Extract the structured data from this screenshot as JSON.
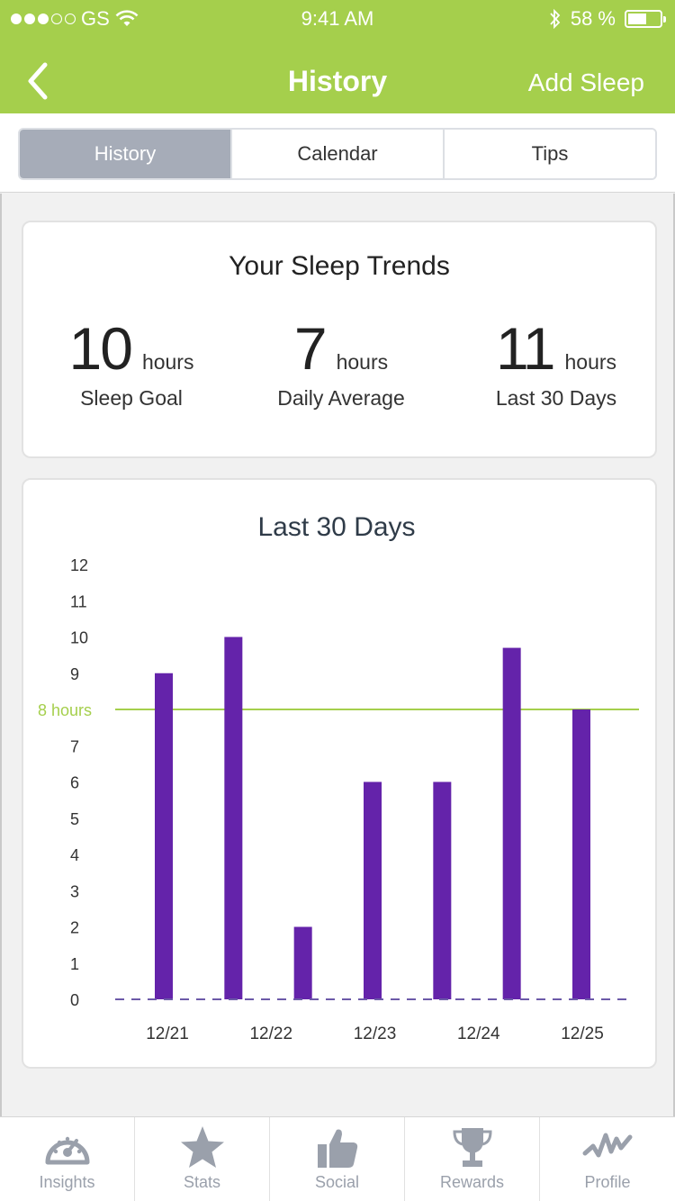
{
  "status_bar": {
    "carrier": "GS",
    "time": "9:41 AM",
    "battery": "58 %"
  },
  "nav": {
    "title": "History",
    "action": "Add Sleep"
  },
  "segments": [
    "History",
    "Calendar",
    "Tips"
  ],
  "trends": {
    "title": "Your Sleep Trends",
    "stats": [
      {
        "value": "10",
        "unit": "hours",
        "label": "Sleep Goal"
      },
      {
        "value": "7",
        "unit": "hours",
        "label": "Daily Average"
      },
      {
        "value": "11",
        "unit": "hours",
        "label": "Last 30 Days"
      }
    ]
  },
  "chart_data": {
    "type": "bar",
    "title": "Last 30 Days",
    "y_ticks": [
      0,
      1,
      2,
      3,
      4,
      5,
      6,
      7,
      8,
      9,
      10,
      11,
      12
    ],
    "ylim": [
      0,
      12
    ],
    "x_tick_labels": [
      "12/21",
      "12/22",
      "12/23",
      "12/24",
      "12/25"
    ],
    "values": [
      9,
      10,
      2,
      6,
      6,
      9.7,
      8
    ],
    "reference_line": {
      "value": 8,
      "label": "8 hours",
      "color": "#a5cf4c"
    },
    "bar_color": "#6423aa",
    "grid": false
  },
  "tabs": [
    {
      "label": "Insights",
      "icon": "gauge-icon"
    },
    {
      "label": "Stats",
      "icon": "star-icon"
    },
    {
      "label": "Social",
      "icon": "thumbs-up-icon"
    },
    {
      "label": "Rewards",
      "icon": "trophy-icon"
    },
    {
      "label": "Profile",
      "icon": "activity-wave-icon"
    }
  ]
}
